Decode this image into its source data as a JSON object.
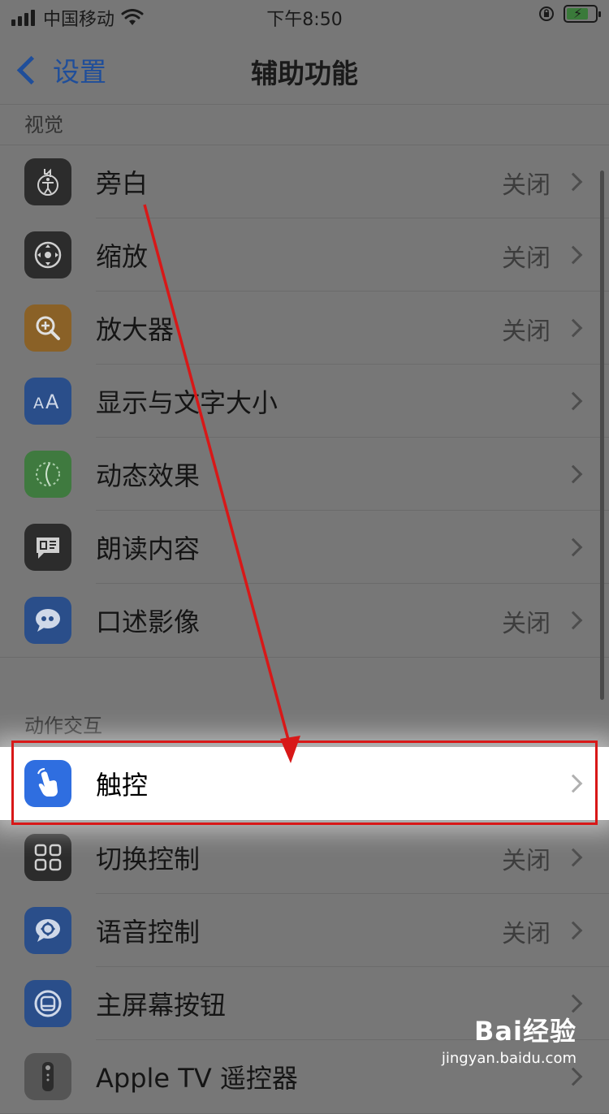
{
  "status_bar": {
    "carrier": "中国移动",
    "time": "下午8:50"
  },
  "nav": {
    "back_label": "设置",
    "title": "辅助功能"
  },
  "sections": [
    {
      "header": "视觉",
      "items": [
        {
          "label": "旁白",
          "value": "关闭",
          "icon": "voiceover-icon",
          "color": "#2c2c2c"
        },
        {
          "label": "缩放",
          "value": "关闭",
          "icon": "zoom-icon",
          "color": "#2c2c2c"
        },
        {
          "label": "放大器",
          "value": "关闭",
          "icon": "magnifier-icon",
          "color": "#8a6127"
        },
        {
          "label": "显示与文字大小",
          "value": "",
          "icon": "text-size-icon",
          "color": "#2a4e8a"
        },
        {
          "label": "动态效果",
          "value": "",
          "icon": "motion-icon",
          "color": "#3f7a3f"
        },
        {
          "label": "朗读内容",
          "value": "",
          "icon": "speech-bubble-icon",
          "color": "#2c2c2c"
        },
        {
          "label": "口述影像",
          "value": "关闭",
          "icon": "quote-bubble-icon",
          "color": "#2a4e8a"
        }
      ]
    },
    {
      "header": "动作交互",
      "items": [
        {
          "label": "触控",
          "value": "",
          "icon": "touch-hand-icon",
          "color": "#2f6ee0",
          "highlighted": true
        },
        {
          "label": "切换控制",
          "value": "关闭",
          "icon": "switch-grid-icon",
          "color": "#2c2c2c"
        },
        {
          "label": "语音控制",
          "value": "关闭",
          "icon": "voice-control-icon",
          "color": "#2a4e8a"
        },
        {
          "label": "主屏幕按钮",
          "value": "",
          "icon": "home-button-icon",
          "color": "#2a4e8a"
        },
        {
          "label": "Apple TV 遥控器",
          "value": "",
          "icon": "tv-remote-icon",
          "color": "#555555"
        }
      ]
    }
  ],
  "watermark": {
    "brand": "Bai经验",
    "url": "jingyan.baidu.com"
  },
  "colors": {
    "annotation": "#d81818",
    "dim_overlay": "#777777"
  }
}
